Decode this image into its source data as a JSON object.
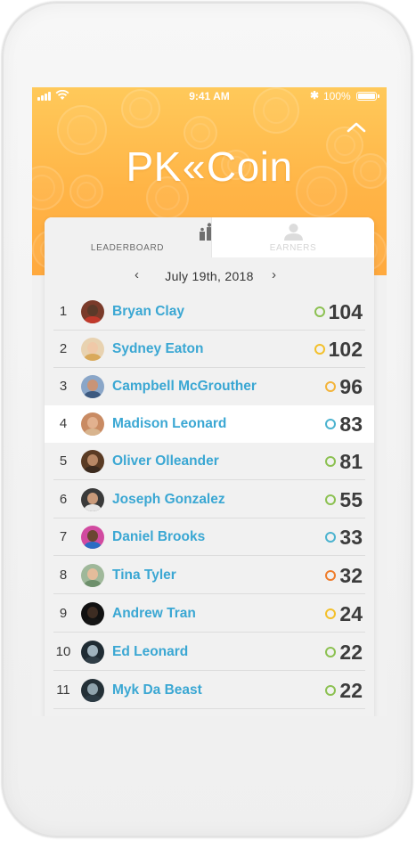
{
  "status_bar": {
    "time": "9:41 AM",
    "battery": "100%",
    "bluetooth_icon": "bluetooth-icon",
    "wifi_icon": "wifi-icon"
  },
  "app": {
    "logo_left": "PK",
    "logo_chevron": "«",
    "logo_right": "Coin"
  },
  "tabs": [
    {
      "label": "LEADERBOARD",
      "icon": "podium-icon",
      "active": true
    },
    {
      "label": "EARNERS",
      "icon": "person-icon",
      "active": false
    }
  ],
  "date": {
    "label": "July 19th, 2018",
    "prev": "‹",
    "next": "›"
  },
  "colors": {
    "header": "#ffb446",
    "name": "#3aa7d3",
    "highlight_row": "#ffffff"
  },
  "leaderboard": [
    {
      "rank": "1",
      "name": "Bryan Clay",
      "score": "104",
      "ring": "#8cc152",
      "skin": "#5b3a29",
      "shirt": "#c0392b",
      "bg": "#7a3b2a"
    },
    {
      "rank": "2",
      "name": "Sydney Eaton",
      "score": "102",
      "ring": "#f3c02b",
      "skin": "#f0c9a8",
      "shirt": "#d9a95a",
      "bg": "#e8d2b0"
    },
    {
      "rank": "3",
      "name": "Campbell McGrouther",
      "score": "96",
      "ring": "#f3b43b",
      "skin": "#c99476",
      "shirt": "#3d5a80",
      "bg": "#8aa6c8"
    },
    {
      "rank": "4",
      "name": "Madison Leonard",
      "score": "83",
      "ring": "#4cb3cf",
      "skin": "#e2b18f",
      "shirt": "#d8b48e",
      "bg": "#c98b63"
    },
    {
      "rank": "5",
      "name": "Oliver Olleander",
      "score": "81",
      "ring": "#8cc152",
      "skin": "#b78765",
      "shirt": "#3b2a1e",
      "bg": "#5a3b24"
    },
    {
      "rank": "6",
      "name": "Joseph Gonzalez",
      "score": "55",
      "ring": "#8cc152",
      "skin": "#c99a7a",
      "shirt": "#e6e6e6",
      "bg": "#3a3a3a"
    },
    {
      "rank": "7",
      "name": "Daniel Brooks",
      "score": "33",
      "ring": "#4cb3cf",
      "skin": "#6b4631",
      "shirt": "#2b6cc4",
      "bg": "#d14aa0"
    },
    {
      "rank": "8",
      "name": "Tina Tyler",
      "score": "32",
      "ring": "#ef7d2c",
      "skin": "#e4bc9b",
      "shirt": "#6d8f6b",
      "bg": "#9fb89a"
    },
    {
      "rank": "9",
      "name": "Andrew Tran",
      "score": "24",
      "ring": "#f3c02b",
      "skin": "#3d2c22",
      "shirt": "#151515",
      "bg": "#111111"
    },
    {
      "rank": "10",
      "name": "Ed Leonard",
      "score": "22",
      "ring": "#8cc152",
      "skin": "#9fb2bd",
      "shirt": "#2f3d46",
      "bg": "#1f2b33"
    },
    {
      "rank": "11",
      "name": "Myk Da Beast",
      "score": "22",
      "ring": "#8cc152",
      "skin": "#8fa3ad",
      "shirt": "#2b3a44",
      "bg": "#243037"
    }
  ]
}
